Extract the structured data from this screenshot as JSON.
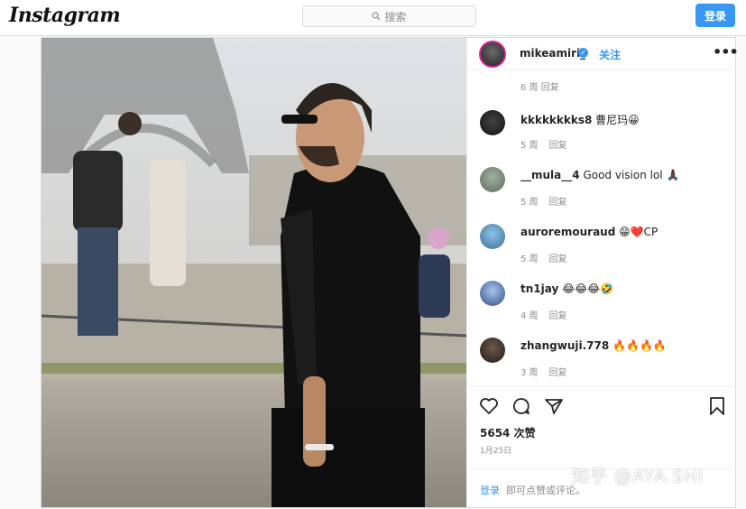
{
  "topbar": {
    "logo": "Instagram",
    "search_placeholder": "搜索",
    "login_label": "登录"
  },
  "post": {
    "author": "mikeamiri_",
    "follow_label": "关注",
    "more_label": "•••",
    "partial_meta": "6 周  回复",
    "comments": [
      {
        "user": "kkkkkkkks8",
        "text": "曹尼玛😀",
        "time": "5 周",
        "reply": "回复"
      },
      {
        "user": "__mula__4",
        "text": "Good vision lol 🙏🏿",
        "time": "5 周",
        "reply": "回复"
      },
      {
        "user": "auroremouraud",
        "text": "😁❤️CP",
        "time": "5 周",
        "reply": "回复"
      },
      {
        "user": "tn1jay",
        "text": "😂😂😂🤣",
        "time": "4 周",
        "reply": "回复"
      },
      {
        "user": "zhangwuji.778",
        "text": "🔥🔥🔥🔥",
        "time": "3 周",
        "reply": "回复"
      }
    ],
    "likes": "5654 次赞",
    "date": "1月25日",
    "login_link": "登录",
    "login_rest": "即可点赞或评论。"
  },
  "watermark": "知乎 @AYA.SHI",
  "colors": {
    "accent": "#3897f0",
    "border": "#dbdbdb",
    "muted": "#8e8e8e"
  },
  "icons": [
    "search-icon",
    "verified-icon",
    "more-icon",
    "heart-icon",
    "comment-icon",
    "share-icon",
    "bookmark-icon"
  ]
}
